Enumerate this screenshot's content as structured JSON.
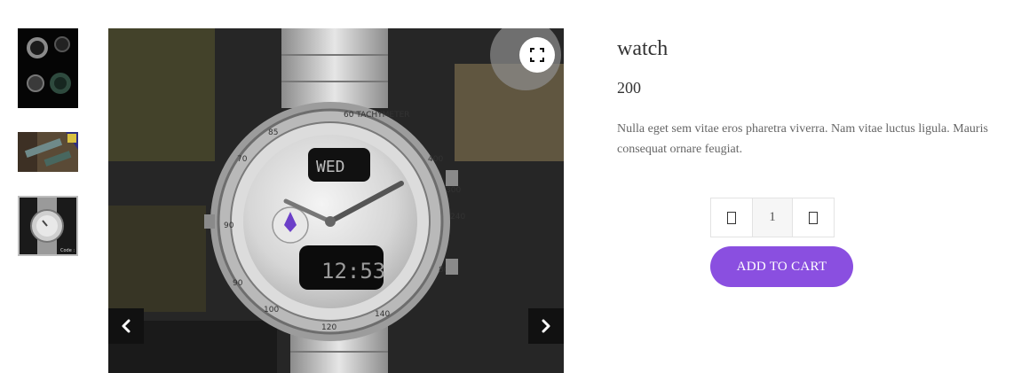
{
  "product": {
    "title": "watch",
    "price": "200",
    "description": "Nulla eget sem vitae eros pharetra viverra. Nam vitae luctus ligula. Mauris consequat ornare feugiat."
  },
  "gallery": {
    "selected_index": 2,
    "thumbnails": [
      {
        "icon": "watch-set-thumbnail"
      },
      {
        "icon": "watch-strap-thumbnail"
      },
      {
        "icon": "silver-watch-thumbnail"
      }
    ],
    "controls": {
      "fullscreen_icon": "expand-icon",
      "prev_icon": "chevron-left-icon",
      "next_icon": "chevron-right-icon"
    }
  },
  "quantity": {
    "value": "1",
    "decrement_icon": "minus-icon",
    "increment_icon": "plus-icon"
  },
  "cart": {
    "add_label": "ADD TO CART"
  },
  "colors": {
    "accent": "#8a4fe0",
    "nav_button": "#111111",
    "text": "#333333",
    "muted_text": "#666666"
  }
}
